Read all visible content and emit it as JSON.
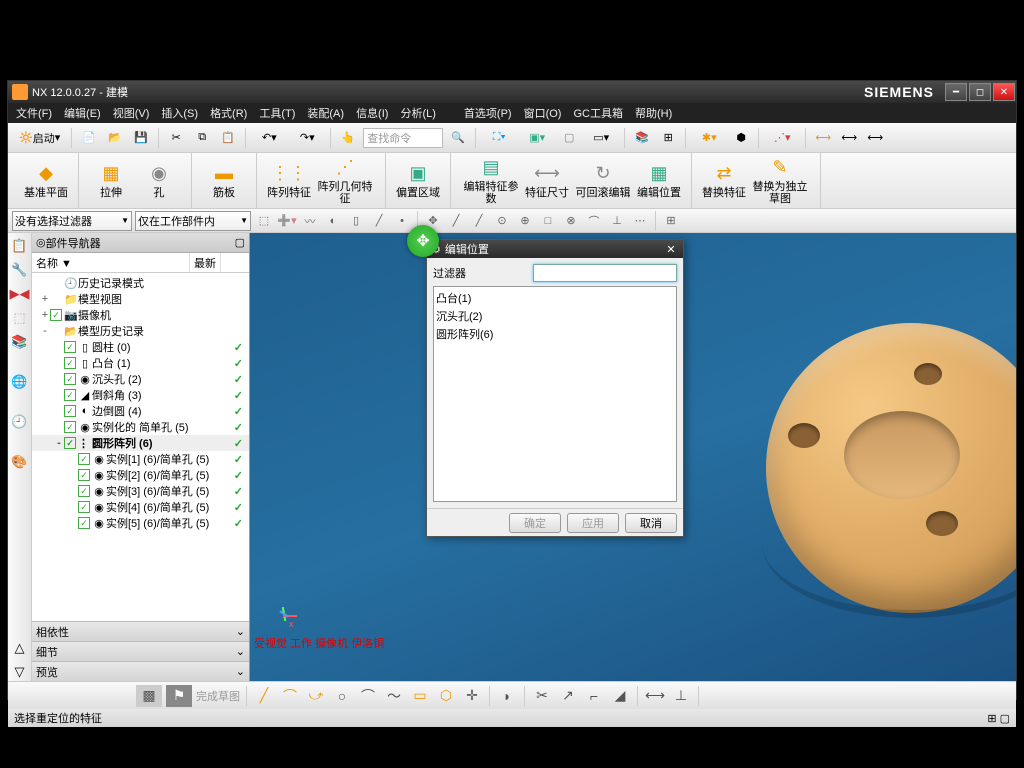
{
  "title": "NX 12.0.0.27 - 建模",
  "brand": "SIEMENS",
  "menu": [
    "文件(F)",
    "编辑(E)",
    "视图(V)",
    "插入(S)",
    "格式(R)",
    "工具(T)",
    "装配(A)",
    "信息(I)",
    "分析(L)",
    "首选项(P)",
    "窗口(O)",
    "GC工具箱",
    "帮助(H)"
  ],
  "toolbar1": {
    "launch": "启动",
    "search_placeholder": "查找命令"
  },
  "ribbon": [
    {
      "label": "基准平面",
      "icon": "◆",
      "color": "#e90"
    },
    {
      "label": "拉伸",
      "icon": "▦",
      "color": "#e90"
    },
    {
      "label": "孔",
      "icon": "◉",
      "color": "#888"
    },
    {
      "label": "筋板",
      "icon": "▬",
      "color": "#e90"
    },
    {
      "label": "阵列特征",
      "icon": "⋮⋮",
      "color": "#e90"
    },
    {
      "label": "阵列几何特征",
      "icon": "⋰",
      "color": "#e90"
    },
    {
      "label": "偏置区域",
      "icon": "▣",
      "color": "#3a8"
    },
    {
      "label": "编辑特征参数",
      "icon": "▤",
      "color": "#3a8"
    },
    {
      "label": "特征尺寸",
      "icon": "⟷",
      "color": "#888"
    },
    {
      "label": "可回滚编辑",
      "icon": "↻",
      "color": "#888"
    },
    {
      "label": "编辑位置",
      "icon": "▦",
      "color": "#3a8"
    },
    {
      "label": "替换特征",
      "icon": "⇄",
      "color": "#e90"
    },
    {
      "label": "替换为独立草图",
      "icon": "✎",
      "color": "#e90"
    }
  ],
  "selbar": {
    "filter1": "没有选择过滤器",
    "filter2": "仅在工作部件内"
  },
  "nav": {
    "title": "部件导航器",
    "col_name": "名称 ▼",
    "col_newest": "最新",
    "tree": [
      {
        "ind": 0,
        "exp": "",
        "chk": false,
        "ico": "🕘",
        "lbl": "历史记录模式",
        "tick": false
      },
      {
        "ind": 0,
        "exp": "+",
        "chk": false,
        "ico": "📁",
        "lbl": "模型视图",
        "tick": false
      },
      {
        "ind": 0,
        "exp": "+",
        "chk": true,
        "ico": "📷",
        "lbl": "摄像机",
        "tick": false
      },
      {
        "ind": 0,
        "exp": "-",
        "chk": false,
        "ico": "📂",
        "lbl": "模型历史记录",
        "tick": false
      },
      {
        "ind": 1,
        "exp": "",
        "chk": true,
        "ico": "▯",
        "lbl": "圆柱 (0)",
        "tick": true
      },
      {
        "ind": 1,
        "exp": "",
        "chk": true,
        "ico": "▯",
        "lbl": "凸台 (1)",
        "tick": true
      },
      {
        "ind": 1,
        "exp": "",
        "chk": true,
        "ico": "◉",
        "lbl": "沉头孔 (2)",
        "tick": true
      },
      {
        "ind": 1,
        "exp": "",
        "chk": true,
        "ico": "◢",
        "lbl": "倒斜角 (3)",
        "tick": true
      },
      {
        "ind": 1,
        "exp": "",
        "chk": true,
        "ico": "◐",
        "lbl": "边倒圆 (4)",
        "tick": true
      },
      {
        "ind": 1,
        "exp": "",
        "chk": true,
        "ico": "◉",
        "lbl": "实例化的 简单孔 (5)",
        "tick": true
      },
      {
        "ind": 1,
        "exp": "-",
        "chk": true,
        "ico": "⋮⋮",
        "lbl": "圆形阵列 (6)",
        "tick": true,
        "sel": true
      },
      {
        "ind": 2,
        "exp": "",
        "chk": true,
        "ico": "◉",
        "lbl": "实例[1] (6)/简单孔 (5)",
        "tick": true
      },
      {
        "ind": 2,
        "exp": "",
        "chk": true,
        "ico": "◉",
        "lbl": "实例[2] (6)/简单孔 (5)",
        "tick": true
      },
      {
        "ind": 2,
        "exp": "",
        "chk": true,
        "ico": "◉",
        "lbl": "实例[3] (6)/简单孔 (5)",
        "tick": true
      },
      {
        "ind": 2,
        "exp": "",
        "chk": true,
        "ico": "◉",
        "lbl": "实例[4] (6)/简单孔 (5)",
        "tick": true
      },
      {
        "ind": 2,
        "exp": "",
        "chk": true,
        "ico": "◉",
        "lbl": "实例[5] (6)/简单孔 (5)",
        "tick": true
      }
    ],
    "acc": [
      "相依性",
      "细节",
      "预览"
    ]
  },
  "viewport_text": "受视觉 工作 摄像机 伊洛铜",
  "bottool_label": "完成草图",
  "status": "选择重定位的特征",
  "dialog": {
    "title": "编辑位置",
    "filter_label": "过滤器",
    "filter_value": "",
    "items": [
      "凸台(1)",
      "沉头孔(2)",
      "圆形阵列(6)"
    ],
    "ok": "确定",
    "apply": "应用",
    "cancel": "取消"
  }
}
